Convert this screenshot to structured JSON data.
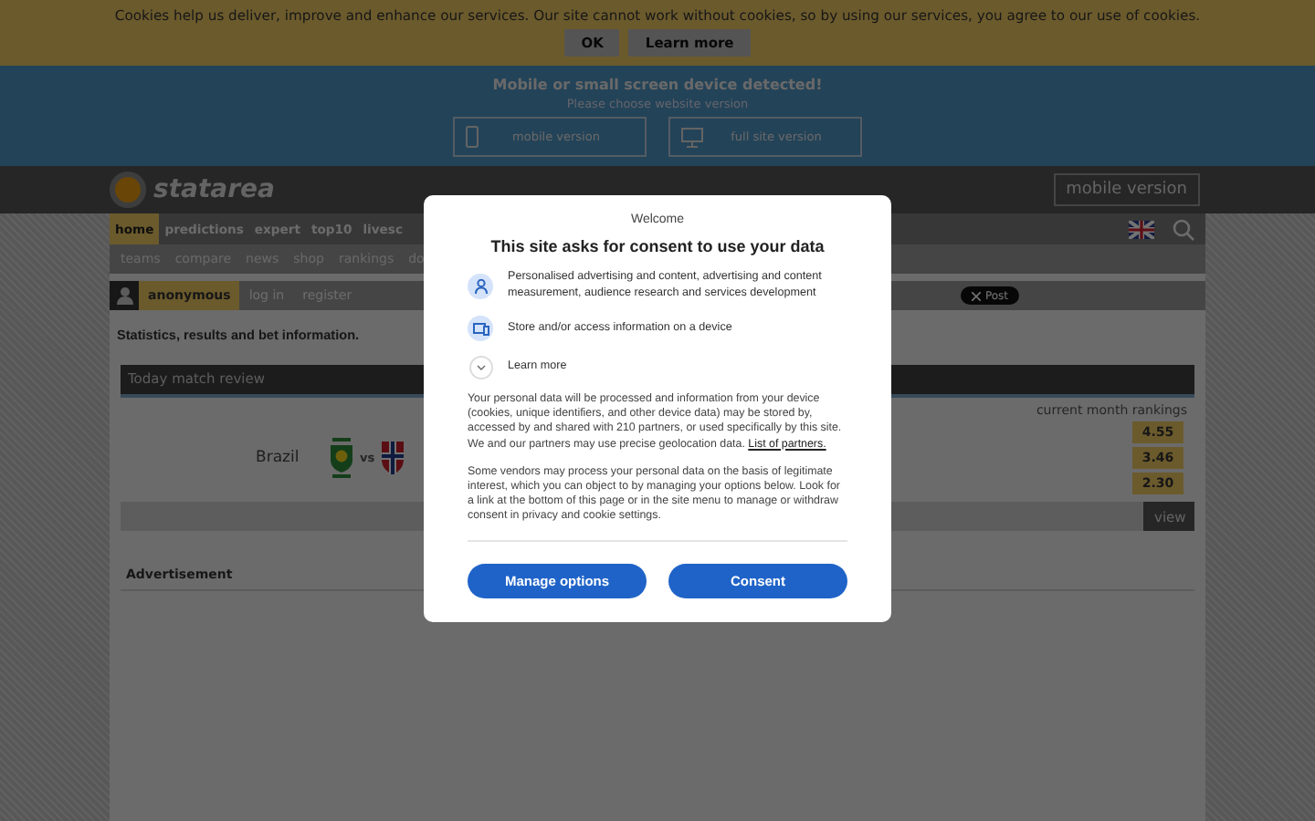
{
  "cookie_bar": {
    "text": "Cookies help us deliver, improve and enhance our services. Our site cannot work without cookies, so by using our services, you agree to our use of cookies.",
    "buttons": [
      "OK",
      "Learn more"
    ]
  },
  "device_banner": {
    "title": "Mobile or small screen device detected!",
    "subtitle": "Please choose website version",
    "options": [
      {
        "kind": "phone",
        "label": "mobile version"
      },
      {
        "kind": "monitor",
        "label": "full site version"
      }
    ]
  },
  "header": {
    "logo": "statarea",
    "mobile_button": "mobile version"
  },
  "nav": [
    {
      "label": "home",
      "selected": true
    },
    {
      "label": "predictions",
      "selected": false
    },
    {
      "label": "expert",
      "selected": false
    },
    {
      "label": "top10",
      "selected": false
    },
    {
      "label": "livesc",
      "selected": false
    }
  ],
  "subnav": [
    "teams",
    "compare",
    "news",
    "shop",
    "rankings",
    "do"
  ],
  "user_bar": {
    "user": "anonymous",
    "links": [
      "log in",
      "register"
    ],
    "post_button": "Post"
  },
  "page_heading": "Statistics, results and bet information.",
  "match_review": {
    "title": "Today match review",
    "rankings_label": "current month rankings",
    "home_team": "Brazil",
    "vs": "vs",
    "odds": [
      "4.55",
      "3.46",
      "2.30"
    ],
    "view": "view"
  },
  "advertisement": "Advertisement",
  "consent": {
    "welcome": "Welcome",
    "title": "This site asks for consent to use your data",
    "purposes": [
      {
        "kind": "person",
        "text": "Personalised advertising and content, advertising and content measurement, audience research and services development"
      },
      {
        "kind": "device",
        "text": "Store and/or access information on a device"
      }
    ],
    "learn_more": "Learn more",
    "paragraphs": [
      {
        "text": "Your personal data will be processed and information from your device (cookies, unique identifiers, and other device data) may be stored by, accessed by and shared with 210 partners, or used specifically by this site. We and our partners may use precise geolocation data.",
        "link": "List of partners."
      },
      {
        "text": "Some vendors may process your personal data on the basis of legitimate interest, which you can object to by managing your options below. Look for a link at the bottom of this page or in the site menu to manage or withdraw consent in privacy and cookie settings."
      }
    ],
    "buttons": [
      "Manage options",
      "Consent"
    ]
  }
}
